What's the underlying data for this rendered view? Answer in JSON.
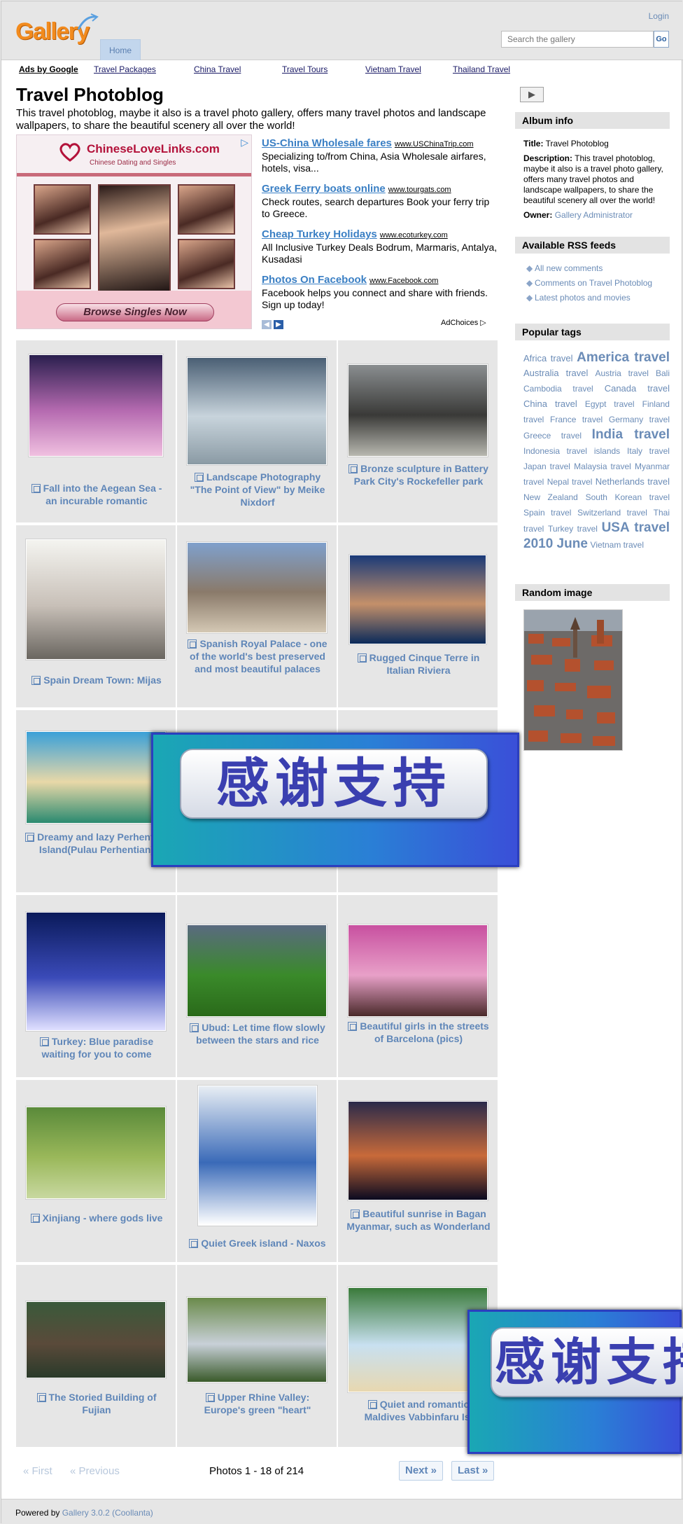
{
  "header": {
    "logo": "Gallery",
    "nav_home": "Home",
    "login": "Login",
    "search_placeholder": "Search the gallery",
    "search_button": "Go"
  },
  "adlinks": {
    "label": "Ads by Google",
    "links": [
      "Travel Packages",
      "China Travel",
      "Travel Tours",
      "Vietnam Travel",
      "Thailand Travel"
    ]
  },
  "main": {
    "title": "Travel Photoblog",
    "description": "This travel photoblog, maybe it also is a travel photo gallery, offers many travel photos and landscape wallpapers, to share the beautiful scenery all over the world!"
  },
  "ad": {
    "banner_brand": "ChineseLoveLinks.com",
    "banner_sub": "Chinese Dating and Singles",
    "banner_button": "Browse Singles Now",
    "items": [
      {
        "title": "US-China Wholesale fares",
        "url": "www.USChinaTrip.com",
        "body": "Specializing to/from China, Asia Wholesale airfares, hotels, visa..."
      },
      {
        "title": "Greek Ferry boats online",
        "url": "www.tourgats.com",
        "body": "Check routes, search departures Book your ferry trip to Greece."
      },
      {
        "title": "Cheap Turkey Holidays",
        "url": "www.ecoturkey.com",
        "body": "All Inclusive Turkey Deals Bodrum, Marmaris, Antalya, Kusadasi"
      },
      {
        "title": "Photos On Facebook",
        "url": "www.Facebook.com",
        "body": "Facebook helps you connect and share with friends. Sign up today!"
      }
    ],
    "adchoices": "AdChoices"
  },
  "photos": [
    {
      "caption": "Fall into the Aegean Sea - an incurable romantic"
    },
    {
      "caption": "Landscape Photography \"The Point of View\" by Meike Nixdorf"
    },
    {
      "caption": "Bronze sculpture in Battery Park City's Rockefeller park"
    },
    {
      "caption": "Spain Dream Town: Mijas"
    },
    {
      "caption": "Spanish Royal Palace - one of the world's best preserved and most beautiful palaces"
    },
    {
      "caption": "Rugged Cinque Terre in Italian Riviera"
    },
    {
      "caption": "Dreamy and lazy Perhentian Island(Pulau Perhentian)"
    },
    {
      "caption": ""
    },
    {
      "caption": ""
    },
    {
      "caption": "Turkey: Blue paradise waiting for you to come"
    },
    {
      "caption": "Ubud: Let time flow slowly between the stars and rice"
    },
    {
      "caption": "Beautiful girls in the streets of Barcelona (pics)"
    },
    {
      "caption": "Xinjiang - where gods live"
    },
    {
      "caption": "Quiet Greek island - Naxos"
    },
    {
      "caption": "Beautiful sunrise in Bagan Myanmar, such as Wonderland"
    },
    {
      "caption": "The Storied Building of Fujian"
    },
    {
      "caption": "Upper Rhine Valley: Europe's green \"heart\""
    },
    {
      "caption": "Quiet and romantic Maldives Vabbinfaru Isl"
    }
  ],
  "pager": {
    "first": "« First",
    "previous": "« Previous",
    "info": "Photos 1 - 18 of 214",
    "next": "Next »",
    "last": "Last »"
  },
  "footer": {
    "powered_by": "Powered by",
    "link": "Gallery 3.0.2 (Coollanta)"
  },
  "sidebar": {
    "album_info_title": "Album info",
    "title_label": "Title:",
    "title_value": "Travel Photoblog",
    "desc_label": "Description:",
    "desc_value": "This travel photoblog, maybe it also is a travel photo gallery, offers many travel photos and landscape wallpapers, to share the beautiful scenery all over the world!",
    "owner_label": "Owner:",
    "owner_value": "Gallery Administrator",
    "rss_title": "Available RSS feeds",
    "rss": [
      "All new comments",
      "Comments on Travel Photoblog",
      "Latest photos and movies"
    ],
    "tags_title": "Popular tags",
    "tags": [
      {
        "t": "Africa travel",
        "s": 1
      },
      {
        "t": "America travel",
        "s": 3
      },
      {
        "t": "Australia travel",
        "s": 1
      },
      {
        "t": "Austria travel",
        "s": 0
      },
      {
        "t": "Bali",
        "s": 0
      },
      {
        "t": "Cambodia travel",
        "s": 0
      },
      {
        "t": "Canada travel",
        "s": 1
      },
      {
        "t": "China travel",
        "s": 1
      },
      {
        "t": "Egypt travel",
        "s": 0
      },
      {
        "t": "Finland travel",
        "s": 0
      },
      {
        "t": "France travel",
        "s": 0
      },
      {
        "t": "Germany travel",
        "s": 0
      },
      {
        "t": "Greece travel",
        "s": 0
      },
      {
        "t": "India travel",
        "s": 3
      },
      {
        "t": "Indonesia travel",
        "s": 0
      },
      {
        "t": "islands",
        "s": 0
      },
      {
        "t": "Italy travel",
        "s": 0
      },
      {
        "t": "Japan travel",
        "s": 0
      },
      {
        "t": "Malaysia travel",
        "s": 0
      },
      {
        "t": "Myanmar travel",
        "s": 0
      },
      {
        "t": "Nepal travel",
        "s": 0
      },
      {
        "t": "Netherlands travel",
        "s": 1
      },
      {
        "t": "New Zealand",
        "s": 0
      },
      {
        "t": "South Korean travel",
        "s": 0
      },
      {
        "t": "Spain travel",
        "s": 0
      },
      {
        "t": "Switzerland travel",
        "s": 0
      },
      {
        "t": "Thai travel",
        "s": 0
      },
      {
        "t": "Turkey travel",
        "s": 0
      },
      {
        "t": "USA travel",
        "s": 3
      },
      {
        "t": "2010 June",
        "s": 3
      },
      {
        "t": "Vietnam travel",
        "s": 0
      }
    ],
    "random_title": "Random image"
  },
  "overlay": {
    "text": "感谢支持",
    "text_partial": "感谢支持"
  },
  "colors": {
    "link": "#6b8cb7",
    "header_bg": "#e6e6e6",
    "cell_bg": "#e6e6e6",
    "logo": "#f28b1e",
    "overlay_border": "#2b3fbf"
  }
}
